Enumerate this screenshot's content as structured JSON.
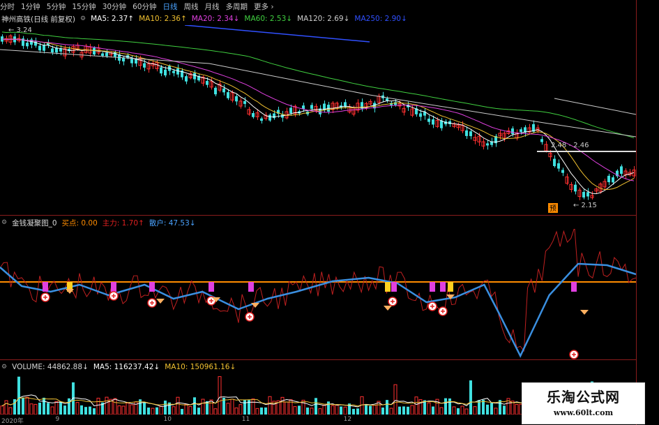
{
  "toolbar": {
    "items": [
      "分时",
      "1分钟",
      "5分钟",
      "15分钟",
      "30分钟",
      "60分钟",
      "日线",
      "周线",
      "月线",
      "多周期",
      "更多"
    ],
    "active_index": 6
  },
  "price_legend": {
    "title": "神州高铁(日线 前复权)",
    "ma": [
      {
        "label": "MA5: 2.37",
        "color": "#ffffff",
        "arrow": "↑"
      },
      {
        "label": "MA10: 2.36",
        "color": "#f0c030",
        "arrow": "↑"
      },
      {
        "label": "MA20: 2.34",
        "color": "#e040e0",
        "arrow": "↓"
      },
      {
        "label": "MA60: 2.53",
        "color": "#40d040",
        "arrow": "↓"
      },
      {
        "label": "MA120: 2.69",
        "color": "#cccccc",
        "arrow": "↓"
      },
      {
        "label": "MA250: 2.90",
        "color": "#3050ff",
        "arrow": "↓"
      }
    ],
    "high_label": "3.24",
    "range_label": "2.48 - 2.46",
    "low_label": "2.15",
    "marker_label": "预"
  },
  "indicator_legend": {
    "title": "金钱凝聚图_0",
    "items": [
      {
        "label": "买点: 0.00",
        "color": "#ff8c00",
        "arrow": ""
      },
      {
        "label": "主力: 1.70",
        "color": "#e02020",
        "arrow": "↑"
      },
      {
        "label": "散户: 47.53",
        "color": "#4aa3ff",
        "arrow": "↓"
      }
    ]
  },
  "volume_legend": {
    "title": "VOLUME: 44862.88",
    "title_arrow": "↓",
    "items": [
      {
        "label": "MA5: 116237.42",
        "color": "#ffffff",
        "arrow": "↓"
      },
      {
        "label": "MA10: 150961.16",
        "color": "#f0c030",
        "arrow": "↓"
      }
    ]
  },
  "x_axis": [
    {
      "label": "2020年",
      "pos": 0.0
    },
    {
      "label": "9",
      "pos": 0.085
    },
    {
      "label": "10",
      "pos": 0.255
    },
    {
      "label": "11",
      "pos": 0.378
    },
    {
      "label": "12",
      "pos": 0.538
    }
  ],
  "watermark": {
    "line1": "乐淘公式网",
    "line2": "www.60lt.com"
  },
  "colors": {
    "up": "#ff3030",
    "down": "#40e0e0",
    "grid": "#8a1c1c"
  }
}
